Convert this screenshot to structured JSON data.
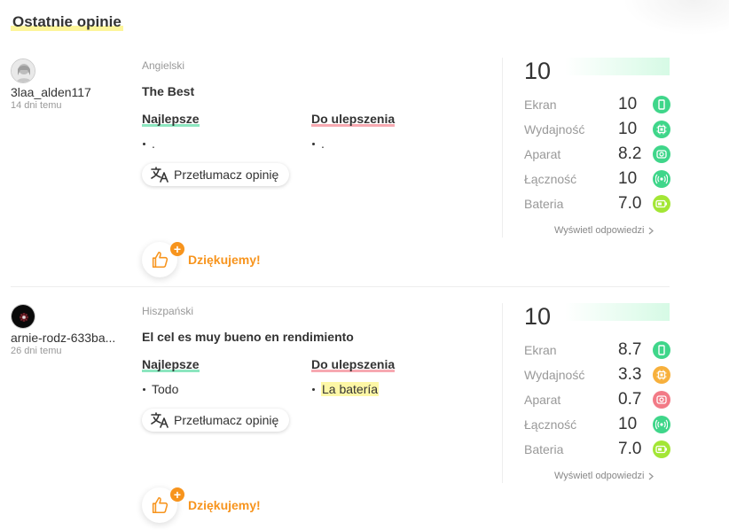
{
  "section": {
    "title": "Ostatnie opinie"
  },
  "labels": {
    "pros_heading": "Najlepsze",
    "cons_heading": "Do ulepszenia",
    "translate": "Przetłumacz opinię",
    "thanks": "Dziękujemy!",
    "show_answers": "Wyświetl odpowiedzi",
    "plus": "+"
  },
  "colors": {
    "green": "#3fd68a",
    "orange": "#f7b03c",
    "pink": "#f27a86",
    "lime": "#a3e635",
    "accent": "#f7941d"
  },
  "reviews": [
    {
      "username": "3laa_alden117",
      "date": "14 dni temu",
      "language": "Angielski",
      "title": "The Best",
      "pros": ".",
      "cons": ".",
      "overall": "10",
      "metrics": [
        {
          "label": "Ekran",
          "value": "10",
          "icon": "screen-icon",
          "color": "#3fd68a"
        },
        {
          "label": "Wydajność",
          "value": "10",
          "icon": "chip-icon",
          "color": "#3fd68a"
        },
        {
          "label": "Aparat",
          "value": "8.2",
          "icon": "camera-icon",
          "color": "#3fd68a"
        },
        {
          "label": "Łączność",
          "value": "10",
          "icon": "signal-icon",
          "color": "#3fd68a"
        },
        {
          "label": "Bateria",
          "value": "7.0",
          "icon": "battery-icon",
          "color": "#a3e635"
        }
      ]
    },
    {
      "username": "arnie-rodz-633ba...",
      "date": "26 dni temu",
      "language": "Hiszpański",
      "title": "El cel es muy bueno en rendimiento",
      "pros": "Todo",
      "cons": "La batería",
      "overall": "10",
      "metrics": [
        {
          "label": "Ekran",
          "value": "8.7",
          "icon": "screen-icon",
          "color": "#3fd68a"
        },
        {
          "label": "Wydajność",
          "value": "3.3",
          "icon": "chip-icon",
          "color": "#f7b03c"
        },
        {
          "label": "Aparat",
          "value": "0.7",
          "icon": "camera-icon",
          "color": "#f27a86"
        },
        {
          "label": "Łączność",
          "value": "10",
          "icon": "signal-icon",
          "color": "#3fd68a"
        },
        {
          "label": "Bateria",
          "value": "7.0",
          "icon": "battery-icon",
          "color": "#a3e635"
        }
      ]
    }
  ]
}
